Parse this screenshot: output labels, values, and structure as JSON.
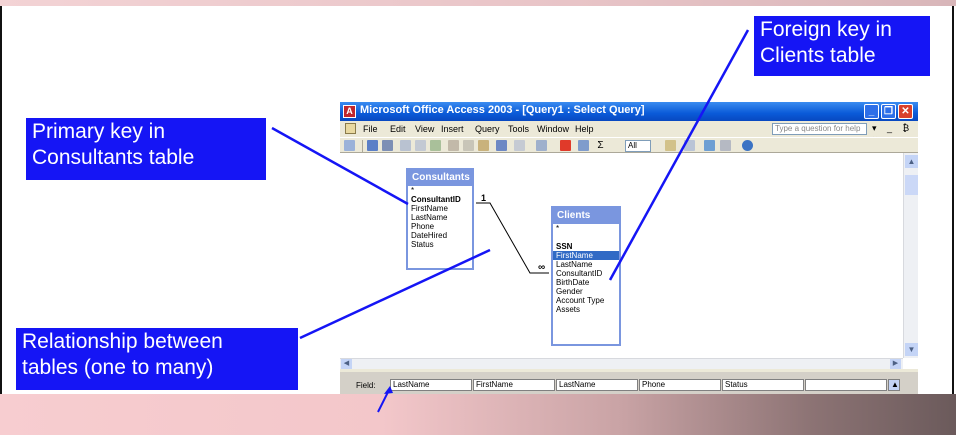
{
  "callouts": {
    "primary": [
      "Primary key in",
      "Consultants table"
    ],
    "foreign": [
      "Foreign key in",
      "Clients table"
    ],
    "relationship": [
      "Relationship between",
      "tables (one to many)"
    ]
  },
  "window": {
    "title": "Microsoft Office Access 2003 - [Query1 : Select Query]",
    "menu": [
      "File",
      "Edit",
      "View",
      "Insert",
      "Query",
      "Tools",
      "Window",
      "Help"
    ],
    "help_placeholder": "Type a question for help",
    "menu_right": "▾ _ ₿ ×",
    "toolbar_combo": "All"
  },
  "tables": {
    "consultants": {
      "name": "Consultants",
      "fields": [
        "*",
        "ConsultantID",
        "FirstName",
        "LastName",
        "Phone",
        "DateHired",
        "Status"
      ]
    },
    "clients": {
      "name": "Clients",
      "fields": [
        "*",
        "",
        "SSN",
        "FirstName",
        "LastName",
        "ConsultantID",
        "BirthDate",
        "Gender",
        "Account Type",
        "Assets"
      ]
    }
  },
  "relationship": {
    "one": "1",
    "many": "∞"
  },
  "grid": {
    "row_label": "Field:",
    "fields": [
      "LastName",
      "FirstName",
      "LastName",
      "Phone",
      "Status",
      ""
    ]
  },
  "colors": {
    "callout": "#1515f5",
    "titlebar": "#0a5ad8",
    "table_header": "#7a96df",
    "selection": "#316ac5"
  }
}
